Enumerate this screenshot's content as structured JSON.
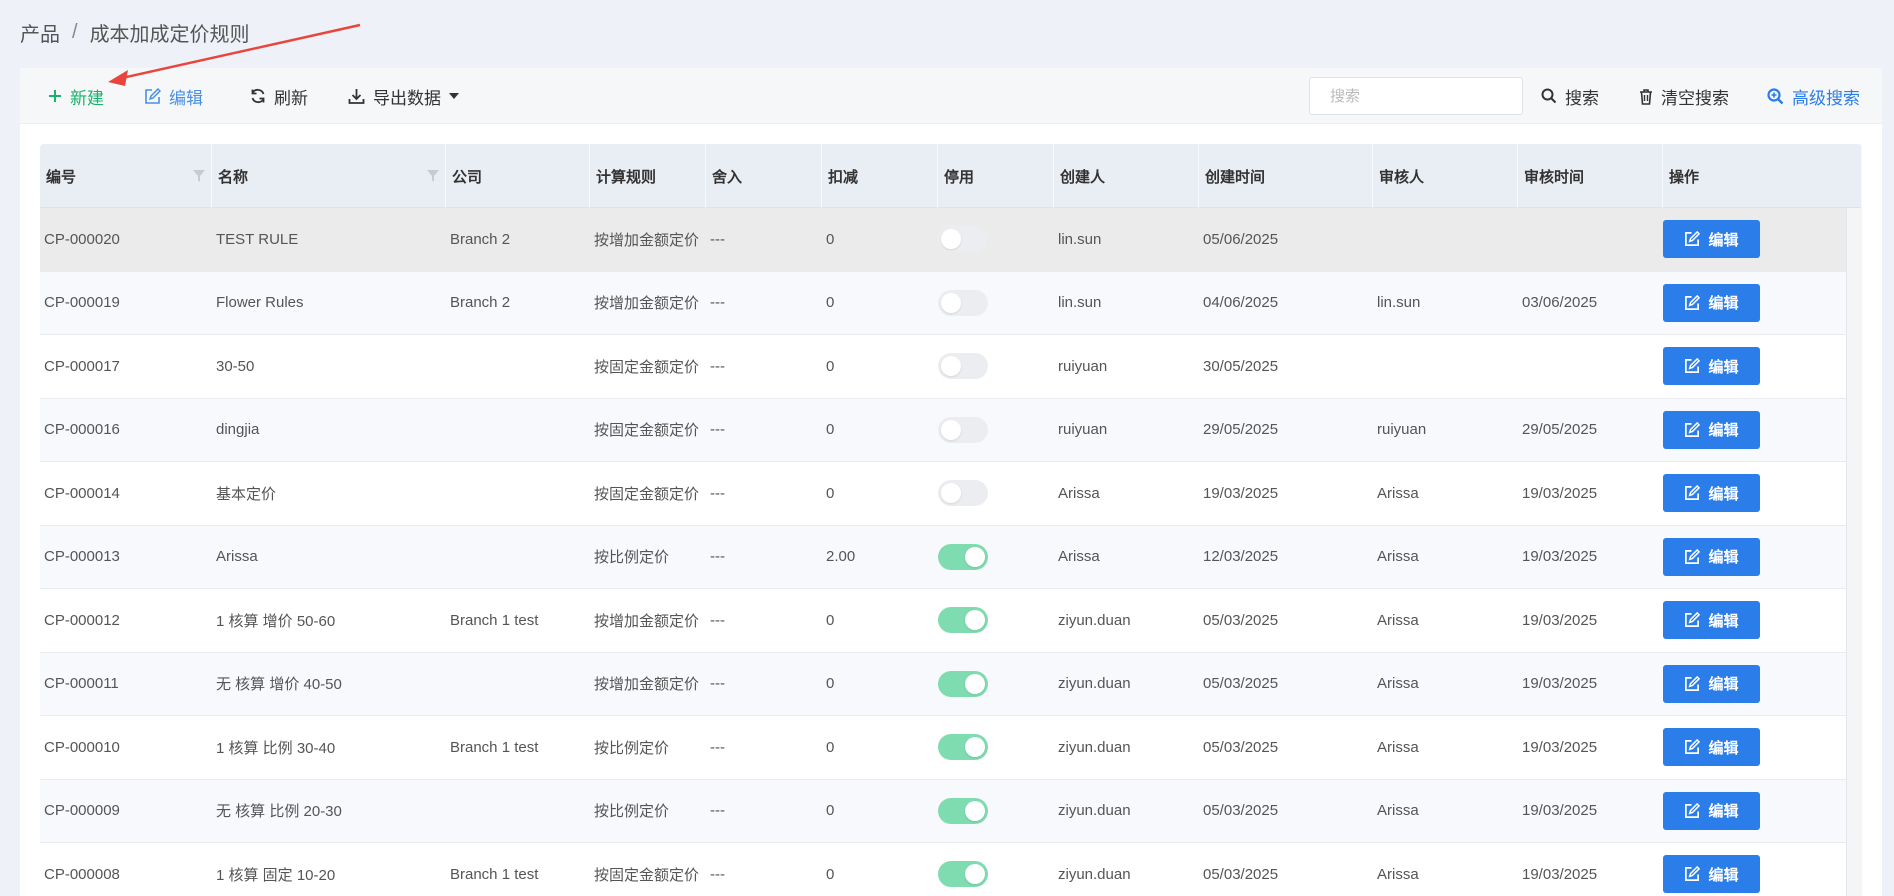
{
  "breadcrumb": {
    "parent": "产品",
    "separator": "/",
    "current": "成本加成定价规则"
  },
  "toolbar": {
    "new_label": "新建",
    "edit_label": "编辑",
    "refresh_label": "刷新",
    "export_label": "导出数据",
    "search_placeholder": "搜索",
    "search_label": "搜索",
    "clear_label": "清空搜索",
    "advanced_label": "高级搜索"
  },
  "columns": [
    "编号",
    "名称",
    "公司",
    "计算规则",
    "舍入",
    "扣减",
    "停用",
    "创建人",
    "创建时间",
    "审核人",
    "审核时间",
    "操作"
  ],
  "row_action_label": "编辑",
  "rows": [
    {
      "code": "CP-000020",
      "name": "TEST RULE",
      "company": "Branch 2",
      "rule": "按增加金额定价",
      "rounding": "---",
      "deduction": "0",
      "disabled": false,
      "creator": "lin.sun",
      "created": "05/06/2025",
      "reviewer": "",
      "reviewed": ""
    },
    {
      "code": "CP-000019",
      "name": "Flower Rules",
      "company": "Branch 2",
      "rule": "按增加金额定价",
      "rounding": "---",
      "deduction": "0",
      "disabled": false,
      "creator": "lin.sun",
      "created": "04/06/2025",
      "reviewer": "lin.sun",
      "reviewed": "03/06/2025"
    },
    {
      "code": "CP-000017",
      "name": "30-50",
      "company": "",
      "rule": "按固定金额定价",
      "rounding": "---",
      "deduction": "0",
      "disabled": false,
      "creator": "ruiyuan",
      "created": "30/05/2025",
      "reviewer": "",
      "reviewed": ""
    },
    {
      "code": "CP-000016",
      "name": "dingjia",
      "company": "",
      "rule": "按固定金额定价",
      "rounding": "---",
      "deduction": "0",
      "disabled": false,
      "creator": "ruiyuan",
      "created": "29/05/2025",
      "reviewer": "ruiyuan",
      "reviewed": "29/05/2025"
    },
    {
      "code": "CP-000014",
      "name": "基本定价",
      "company": "",
      "rule": "按固定金额定价",
      "rounding": "---",
      "deduction": "0",
      "disabled": false,
      "creator": "Arissa",
      "created": "19/03/2025",
      "reviewer": "Arissa",
      "reviewed": "19/03/2025"
    },
    {
      "code": "CP-000013",
      "name": "Arissa",
      "company": "",
      "rule": "按比例定价",
      "rounding": "---",
      "deduction": "2.00",
      "disabled": true,
      "creator": "Arissa",
      "created": "12/03/2025",
      "reviewer": "Arissa",
      "reviewed": "19/03/2025"
    },
    {
      "code": "CP-000012",
      "name": "1 核算 增价 50-60",
      "company": "Branch 1 test",
      "rule": "按增加金额定价",
      "rounding": "---",
      "deduction": "0",
      "disabled": true,
      "creator": "ziyun.duan",
      "created": "05/03/2025",
      "reviewer": "Arissa",
      "reviewed": "19/03/2025"
    },
    {
      "code": "CP-000011",
      "name": "无 核算 增价 40-50",
      "company": "",
      "rule": "按增加金额定价",
      "rounding": "---",
      "deduction": "0",
      "disabled": true,
      "creator": "ziyun.duan",
      "created": "05/03/2025",
      "reviewer": "Arissa",
      "reviewed": "19/03/2025"
    },
    {
      "code": "CP-000010",
      "name": "1 核算 比例 30-40",
      "company": "Branch 1 test",
      "rule": "按比例定价",
      "rounding": "---",
      "deduction": "0",
      "disabled": true,
      "creator": "ziyun.duan",
      "created": "05/03/2025",
      "reviewer": "Arissa",
      "reviewed": "19/03/2025"
    },
    {
      "code": "CP-000009",
      "name": "无 核算 比例 20-30",
      "company": "",
      "rule": "按比例定价",
      "rounding": "---",
      "deduction": "0",
      "disabled": true,
      "creator": "ziyun.duan",
      "created": "05/03/2025",
      "reviewer": "Arissa",
      "reviewed": "19/03/2025"
    },
    {
      "code": "CP-000008",
      "name": "1 核算 固定 10-20",
      "company": "Branch 1 test",
      "rule": "按固定金额定价",
      "rounding": "---",
      "deduction": "0",
      "disabled": true,
      "creator": "ziyun.duan",
      "created": "05/03/2025",
      "reviewer": "Arissa",
      "reviewed": "19/03/2025"
    }
  ],
  "colors": {
    "accent": "#2b7de9",
    "new_green": "#19b369",
    "toggle_on": "#7fdcb0",
    "annotation_arrow": "#e8453c"
  }
}
